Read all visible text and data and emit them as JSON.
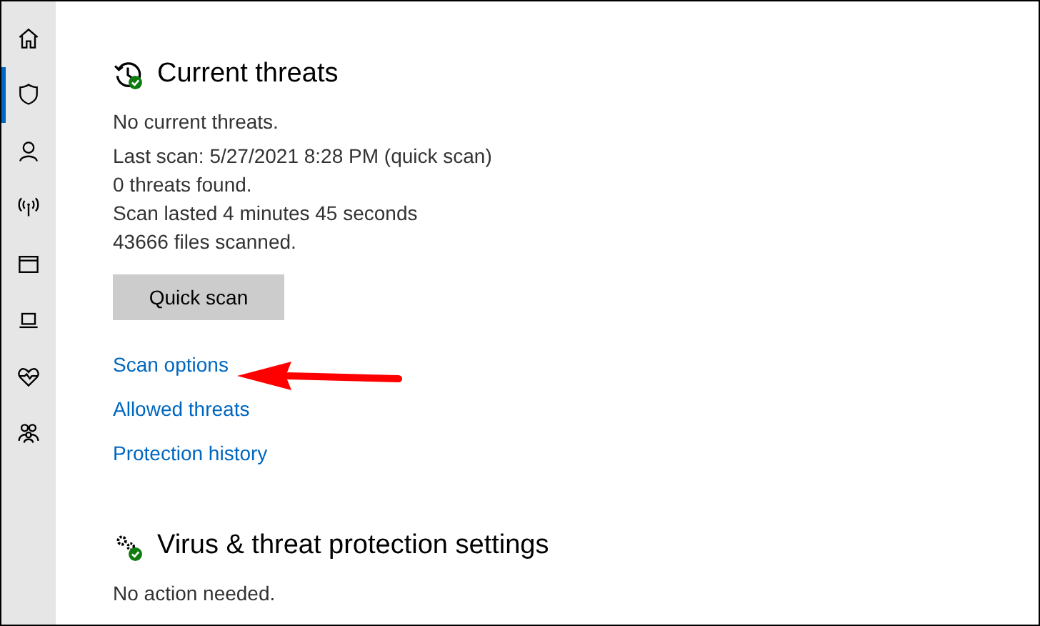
{
  "sidebar": {
    "items": [
      {
        "selected": false
      },
      {
        "selected": true
      },
      {
        "selected": false
      },
      {
        "selected": false
      },
      {
        "selected": false
      },
      {
        "selected": false
      },
      {
        "selected": false
      },
      {
        "selected": false
      }
    ]
  },
  "sections": [
    {
      "title": "Current threats",
      "lines": [
        "No current threats.",
        "Last scan: 5/27/2021 8:28 PM (quick scan)",
        "0 threats found.",
        "Scan lasted 4 minutes 45 seconds",
        "43666 files scanned."
      ],
      "button": "Quick scan",
      "links": [
        "Scan options",
        "Allowed threats",
        "Protection history"
      ]
    },
    {
      "title": "Virus & threat protection settings",
      "lines": [
        "No action needed."
      ]
    }
  ]
}
